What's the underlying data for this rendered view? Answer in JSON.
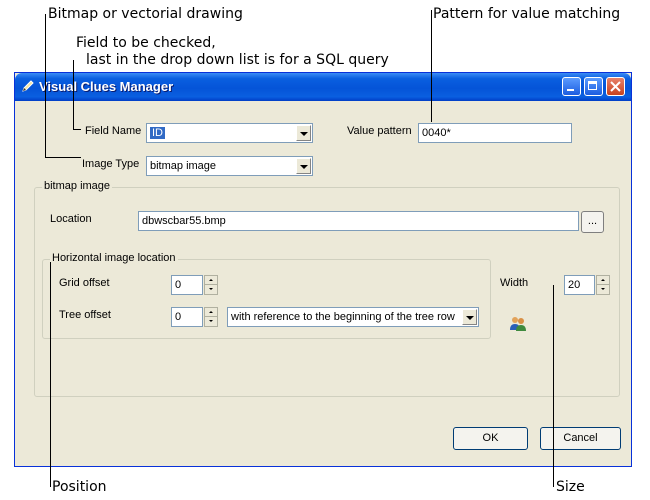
{
  "callouts": {
    "drawing_type": "Bitmap or vectorial drawing",
    "field_checked_line1": "Field to be checked,",
    "field_checked_line2": "last in the drop down list is for a SQL query",
    "pattern": "Pattern for value matching",
    "position": "Position",
    "size": "Size"
  },
  "window": {
    "title": "Visual Clues Manager",
    "icon": "pencil-icon",
    "controls": [
      "minimize-icon",
      "maximize-icon",
      "close-icon"
    ]
  },
  "form": {
    "field_name_label": "Field Name",
    "field_name_value": "ID",
    "value_pattern_label": "Value pattern",
    "value_pattern_value": "0040*",
    "image_type_label": "Image Type",
    "image_type_value": "bitmap image"
  },
  "bitmap_group": {
    "title": "bitmap image",
    "location_label": "Location",
    "location_value": "dbwscbar55.bmp",
    "browse_label": "..."
  },
  "horizontal_group": {
    "title": "Horizontal image location",
    "grid_offset_label": "Grid offset",
    "grid_offset_value": "0",
    "tree_offset_label": "Tree offset",
    "tree_offset_value": "0",
    "tree_reference_value": "with reference to the beginning of the tree row"
  },
  "width": {
    "label": "Width",
    "value": "20",
    "icon": "users-icon"
  },
  "buttons": {
    "ok": "OK",
    "cancel": "Cancel"
  },
  "colors": {
    "titlebar": "#0554d8",
    "dialog_bg": "#ece9d8",
    "selection": "#316ac5"
  }
}
